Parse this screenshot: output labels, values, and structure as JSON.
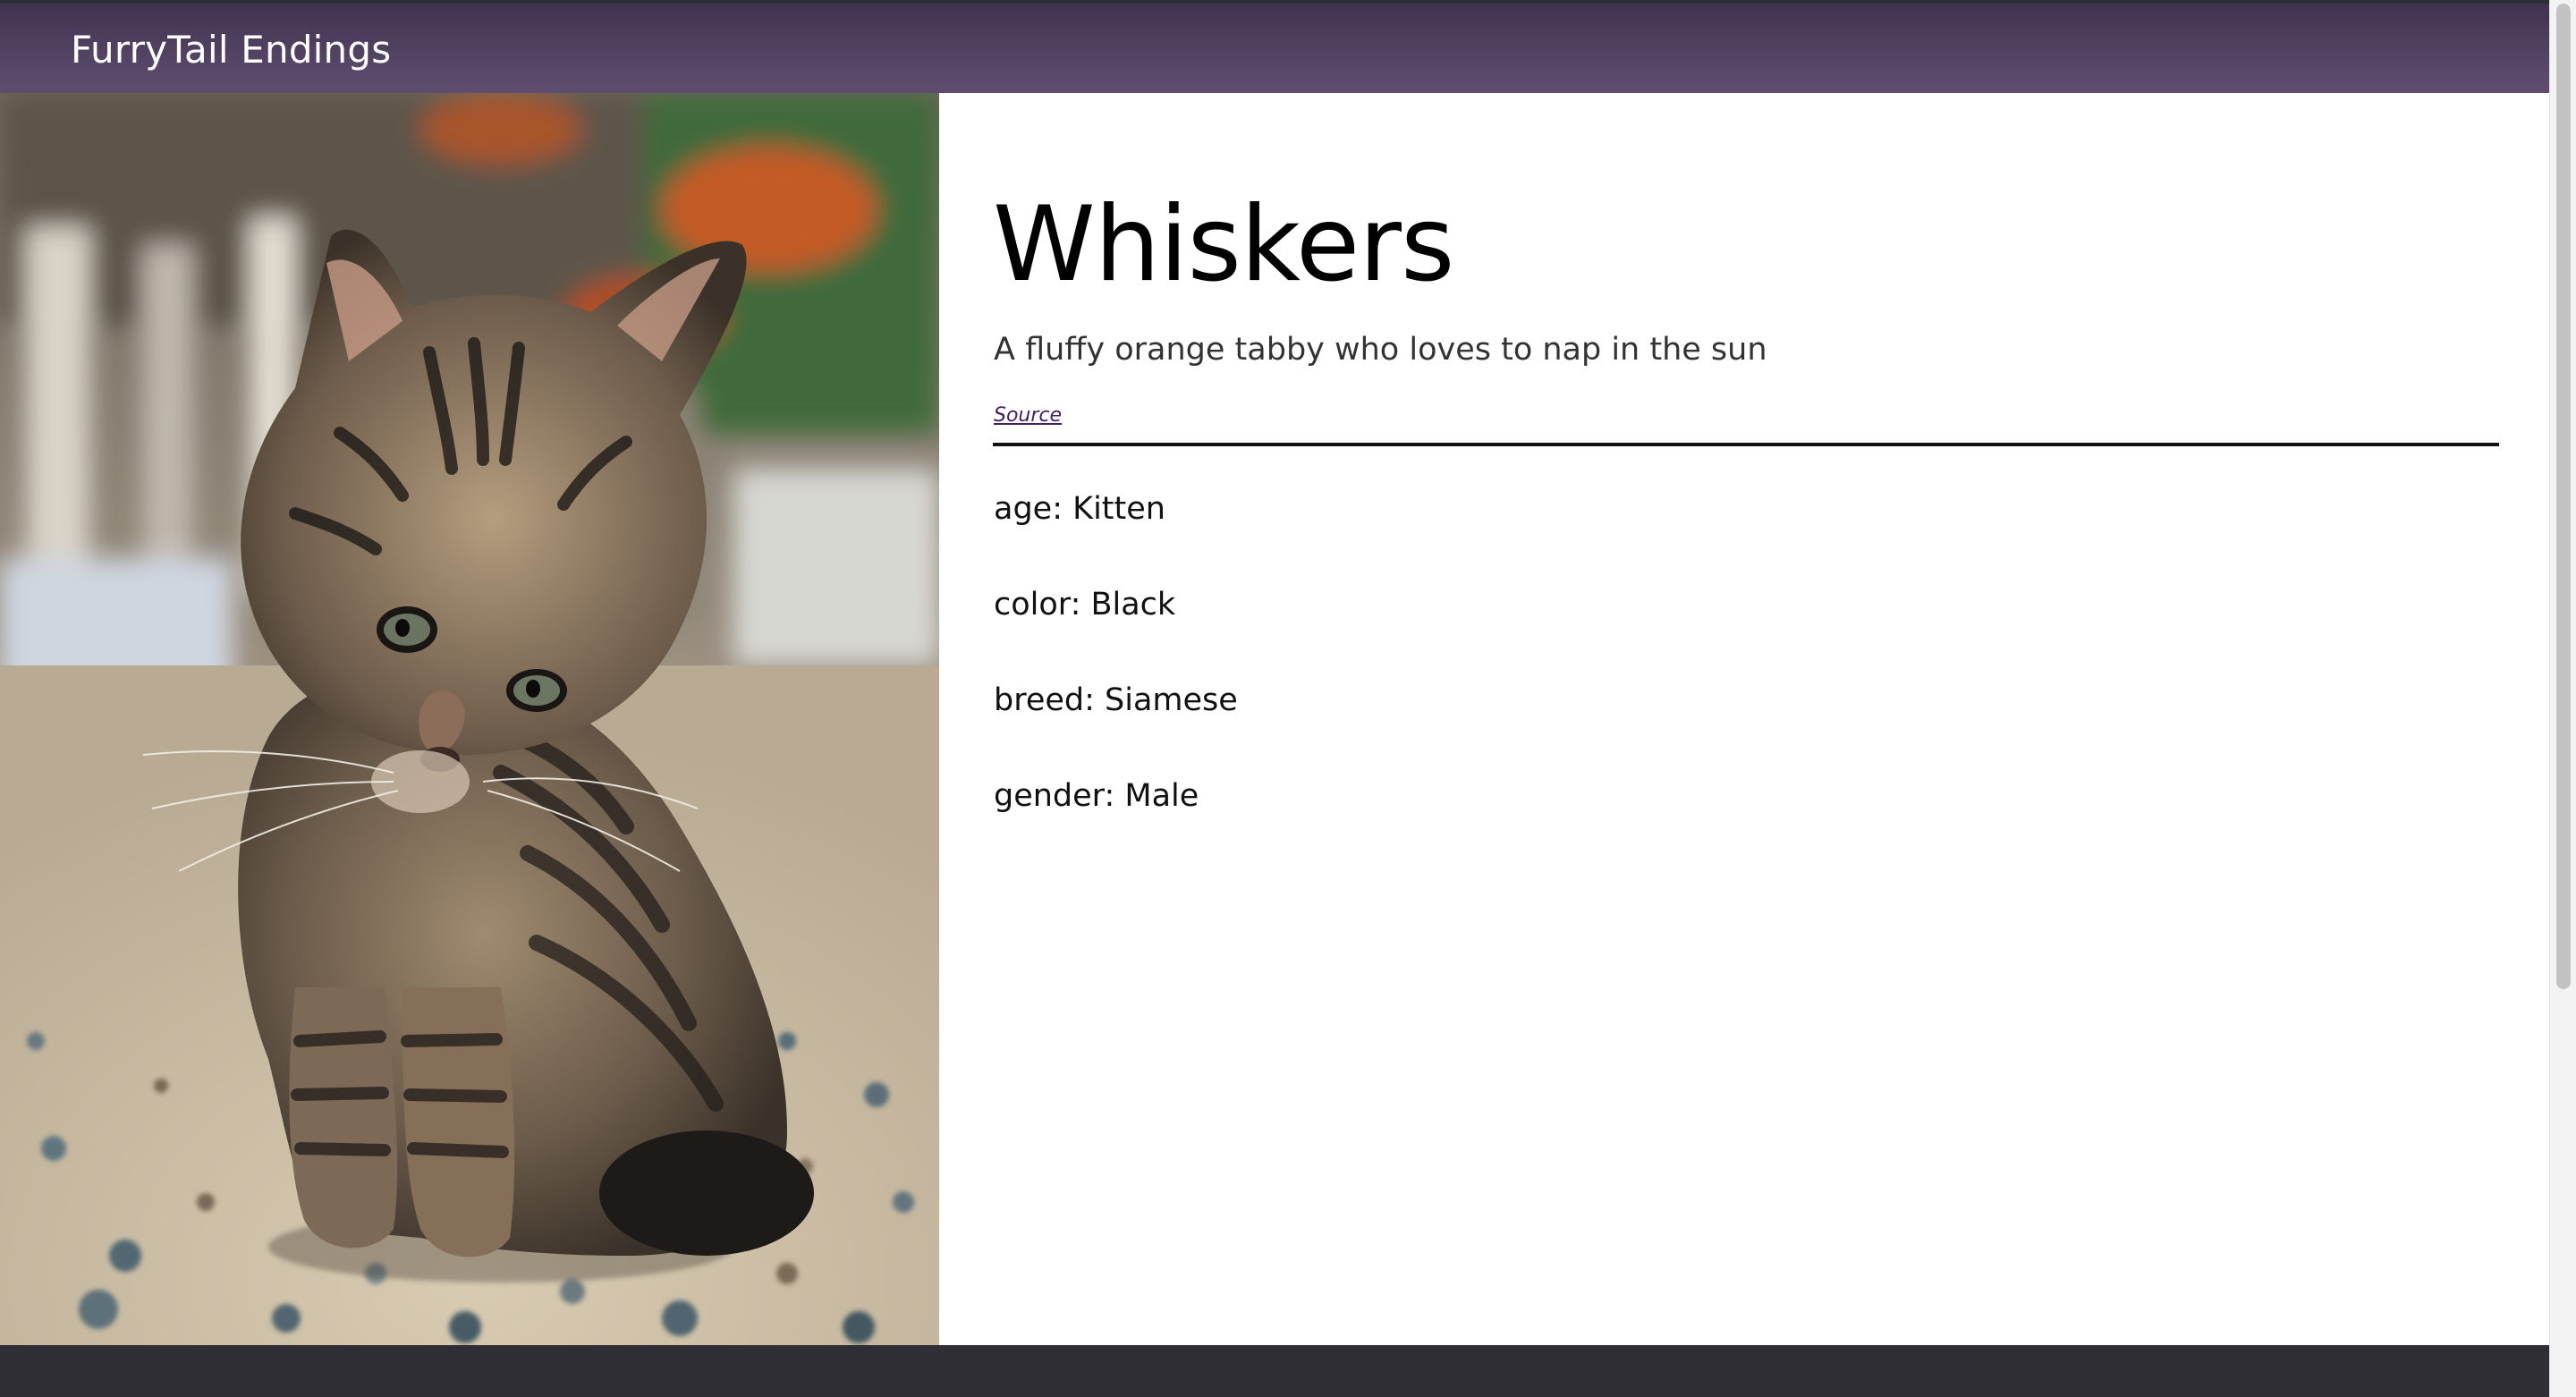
{
  "navbar": {
    "brand": "FurryTail Endings"
  },
  "pet": {
    "name": "Whiskers",
    "description": "A fluffy orange tabby who loves to nap in the sun",
    "source_label": "Source",
    "photo_subject": "tabby-kitten-photo",
    "attributes": [
      {
        "text": "age: Kitten"
      },
      {
        "text": "color: Black"
      },
      {
        "text": "breed: Siamese"
      },
      {
        "text": "gender: Male"
      }
    ]
  },
  "colors": {
    "navbar": "#524262",
    "footer": "#2e2e34",
    "link": "#3f1f66",
    "divider": "#111111"
  }
}
